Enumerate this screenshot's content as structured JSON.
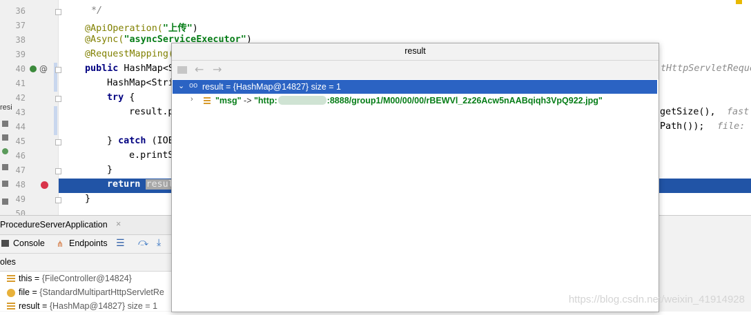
{
  "editor": {
    "line_numbers": [
      "36",
      "37",
      "38",
      "39",
      "40",
      "41",
      "42",
      "43",
      "44",
      "45",
      "46",
      "47",
      "48",
      "49",
      "50"
    ],
    "lines": {
      "l36": "*/",
      "l37_ann": "@ApiOperation(",
      "l37_str": "\"上传\"",
      "l37_end": ")",
      "l38_ann": "@Async(",
      "l38_str": "\"asyncServiceExecutor\"",
      "l38_end": ")",
      "l39_ann": "@RequestMapping(",
      "l40_kw": "public",
      "l40_rest": " HashMap<S",
      "l41": "HashMap<Stri",
      "l42_kw": "try",
      "l42_rest": " {",
      "l43": "result.p",
      "l45_a": "} ",
      "l45_kw": "catch",
      "l45_b": " (IOE",
      "l46": "e.printS",
      "l47": "}",
      "l48_kw": "return",
      "l48_rest": "resul",
      "l49": "}",
      "right_l40": "tHttpServletReque",
      "right_l43_a": "getSize(),",
      "right_l43_b": "fast",
      "right_l44_a": "Path());",
      "right_l44_b": "file:"
    }
  },
  "popup": {
    "title": "result",
    "root_label": "result = {HashMap@14827}  size = 1",
    "child_key": "\"msg\"",
    "child_arrow": " -> ",
    "child_value_prefix": "\"http:",
    "child_value_suffix": ":8888/group1/M00/00/00/rBEWVl_2z26Acw5nAABqiqh3VpQ922.jpg\""
  },
  "debug": {
    "run_tab": "ProcedureServerApplication",
    "close_glyph": "×",
    "console_tab": "Console",
    "endpoints_tab": "Endpoints",
    "vars_header": "oles",
    "vars": [
      {
        "name": "this",
        "eq": " = ",
        "value": "{FileController@14824}"
      },
      {
        "name": "file",
        "eq": " = ",
        "value": "{StandardMultipartHttpServletRe"
      },
      {
        "name": "result",
        "eq": " = ",
        "value": "{HashMap@14827}  size = 1"
      }
    ],
    "left_strip_text": "resi"
  },
  "watermark": "https://blog.csdn.net/weixin_41914928"
}
